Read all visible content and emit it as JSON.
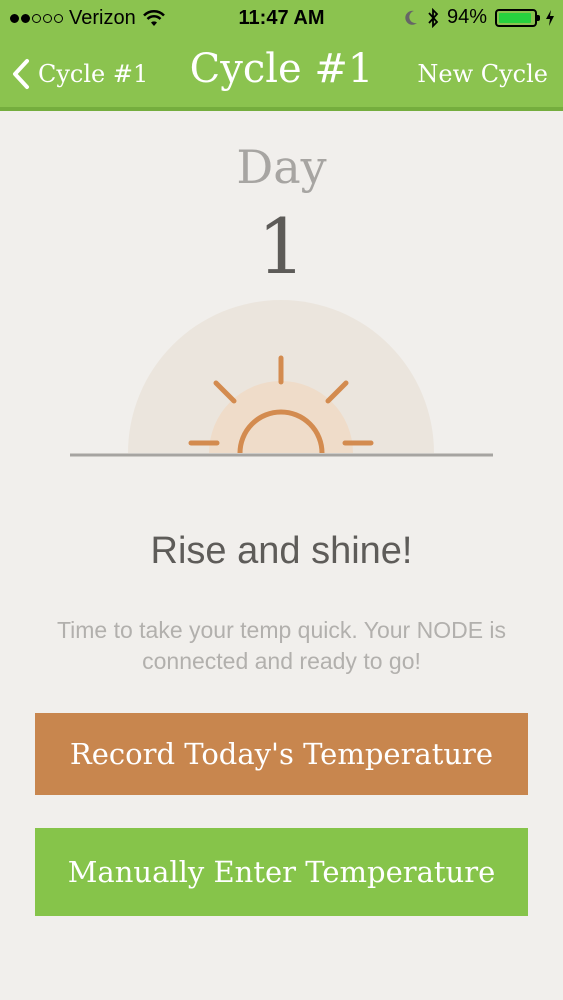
{
  "status_bar": {
    "carrier": "Verizon",
    "time": "11:47 AM",
    "battery_percent": "94%",
    "battery_level": 0.94,
    "signal_bars_filled": 2,
    "signal_bars_total": 5,
    "icons": [
      "wifi-icon",
      "moon-icon",
      "bluetooth-icon",
      "battery-icon",
      "charging-icon"
    ]
  },
  "nav": {
    "back_label": "Cycle #1",
    "title": "Cycle #1",
    "action_label": "New Cycle"
  },
  "day": {
    "label": "Day",
    "number": "1"
  },
  "illustration": {
    "name": "sunrise-icon"
  },
  "message": {
    "headline": "Rise and shine!",
    "body": "Time to take your temp quick. Your NODE is connected and ready to go!"
  },
  "actions": {
    "record_label": "Record Today's Temperature",
    "manual_label": "Manually Enter Temperature"
  },
  "colors": {
    "header_green": "#8bc34f",
    "record_orange": "#c8864e",
    "manual_green": "#86c44a",
    "background": "#f1efec",
    "sun_orange": "#d38b4f"
  }
}
